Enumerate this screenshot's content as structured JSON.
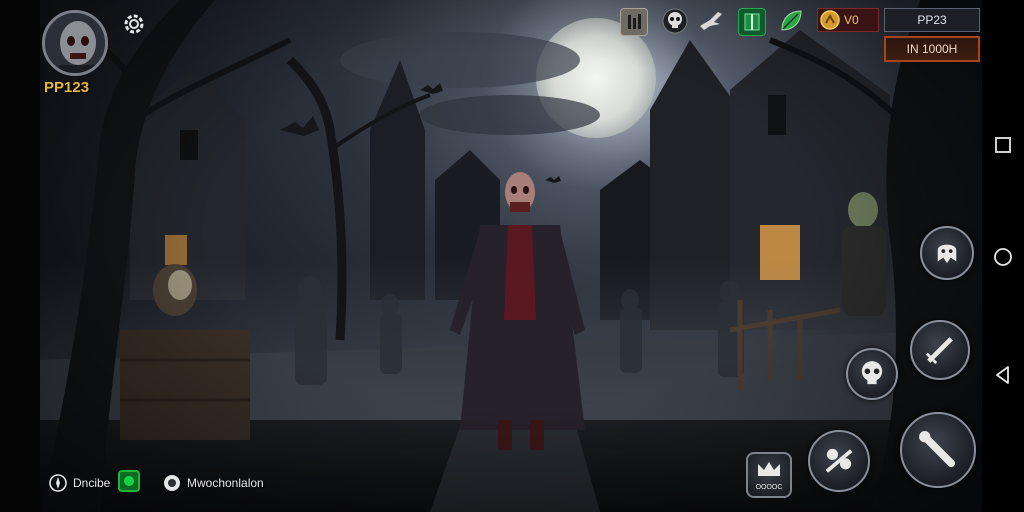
{
  "player": {
    "name": "PP123"
  },
  "top_bar": {
    "icons": [
      "stats-icon",
      "skull-icon",
      "eagle-icon",
      "map-icon",
      "leaf-icon"
    ],
    "currency_value": "V0",
    "rank": "PP23",
    "status": "IN 1000H"
  },
  "bottom_bar": {
    "item1_label": "Dncibe",
    "item2_label": "Mwochonlalon"
  },
  "actions": {
    "menu_label": "OOOOC"
  },
  "colors": {
    "player_name": "#e6b83a",
    "status_border": "#a4451c",
    "toggle_green": "#1eb33d"
  }
}
